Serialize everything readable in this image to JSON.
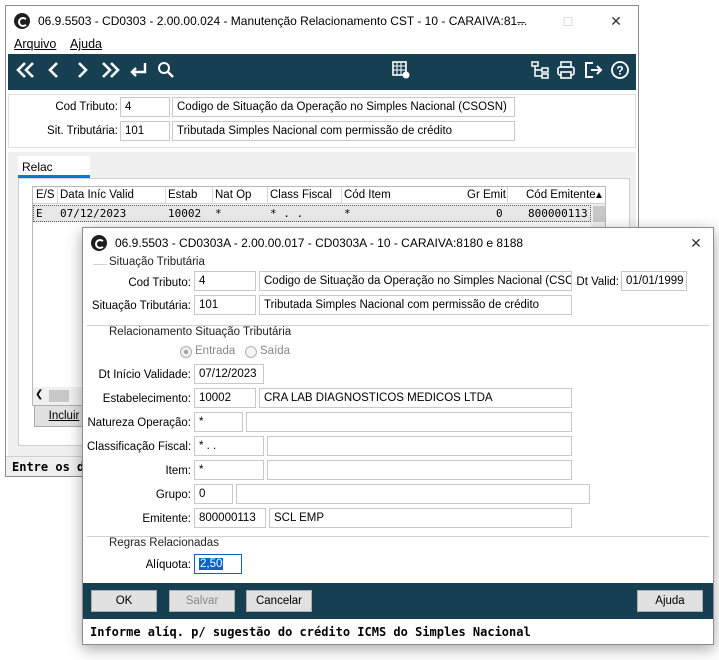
{
  "main_window": {
    "title": "06.9.5503 - CD0303 - 2.00.00.024 - Manutenção Relacionamento CST - 10 - CARAIVA:81...",
    "menu": [
      "Arquivo",
      "Ajuda"
    ],
    "cod_tributo_label": "Cod Tributo:",
    "cod_tributo_value": "4",
    "cod_tributo_desc": "Codigo de Situação da Operação no Simples Nacional (CSOSN)",
    "sit_trib_label": "Sit. Tributária:",
    "sit_trib_value": "101",
    "sit_trib_desc": "Tributada Simples Nacional com permissão de crédito",
    "tab_label": "Relac",
    "columns": [
      "E/S",
      "Data Iníc Valid",
      "Estab",
      "Nat Op",
      "Class Fiscal",
      "Cód Item",
      "Gr Emit",
      "Cód Emitente"
    ],
    "row": [
      "E",
      "07/12/2023",
      "10002",
      "*",
      "* . .",
      "*",
      "0",
      "800000113"
    ],
    "include_button": "Incluir",
    "status_text": "Entre os d"
  },
  "dialog": {
    "title": "06.9.5503 - CD0303A - 2.00.00.017 - CD0303A - 10 - CARAIVA:8180 e 8188",
    "section_situacao": "Situação Tributária",
    "cod_tributo_label": "Cod Tributo:",
    "cod_tributo_value": "4",
    "cod_tributo_desc": "Codigo de Situação da Operação no Simples Nacional (CSOSN)",
    "dt_valid_label": "Dt Valid:",
    "dt_valid_value": "01/01/1999",
    "sit_trib_label": "Situação Tributária:",
    "sit_trib_value": "101",
    "sit_trib_desc": "Tributada Simples Nacional com permissão de crédito",
    "section_relac": "Relacionamento Situação Tributária",
    "radio_entrada": "Entrada",
    "radio_saida": "Saída",
    "dt_inicio_label": "Dt Início Validade:",
    "dt_inicio_value": "07/12/2023",
    "estab_label": "Estabelecimento:",
    "estab_value": "10002",
    "estab_desc": "CRA LAB DIAGNOSTICOS MEDICOS LTDA",
    "nat_op_label": "Natureza Operação:",
    "nat_op_value": "*",
    "class_fiscal_label": "Classificação Fiscal:",
    "class_fiscal_value": "* . .",
    "item_label": "Item:",
    "item_value": "*",
    "grupo_label": "Grupo:",
    "grupo_value": "0",
    "emitente_label": "Emitente:",
    "emitente_value": "800000113",
    "emitente_desc": "SCL EMP",
    "section_regras": "Regras Relacionadas",
    "aliquota_label": "Alíquota:",
    "aliquota_value": "2,50",
    "btn_ok": "OK",
    "btn_salvar": "Salvar",
    "btn_cancelar": "Cancelar",
    "btn_ajuda": "Ajuda",
    "status_text": "Informe alíq. p/ sugestão do crédito ICMS do Simples Nacional"
  },
  "colors": {
    "toolbar": "#173f52",
    "selection": "#0a64c8",
    "tab_underline": "#0a78d7"
  }
}
